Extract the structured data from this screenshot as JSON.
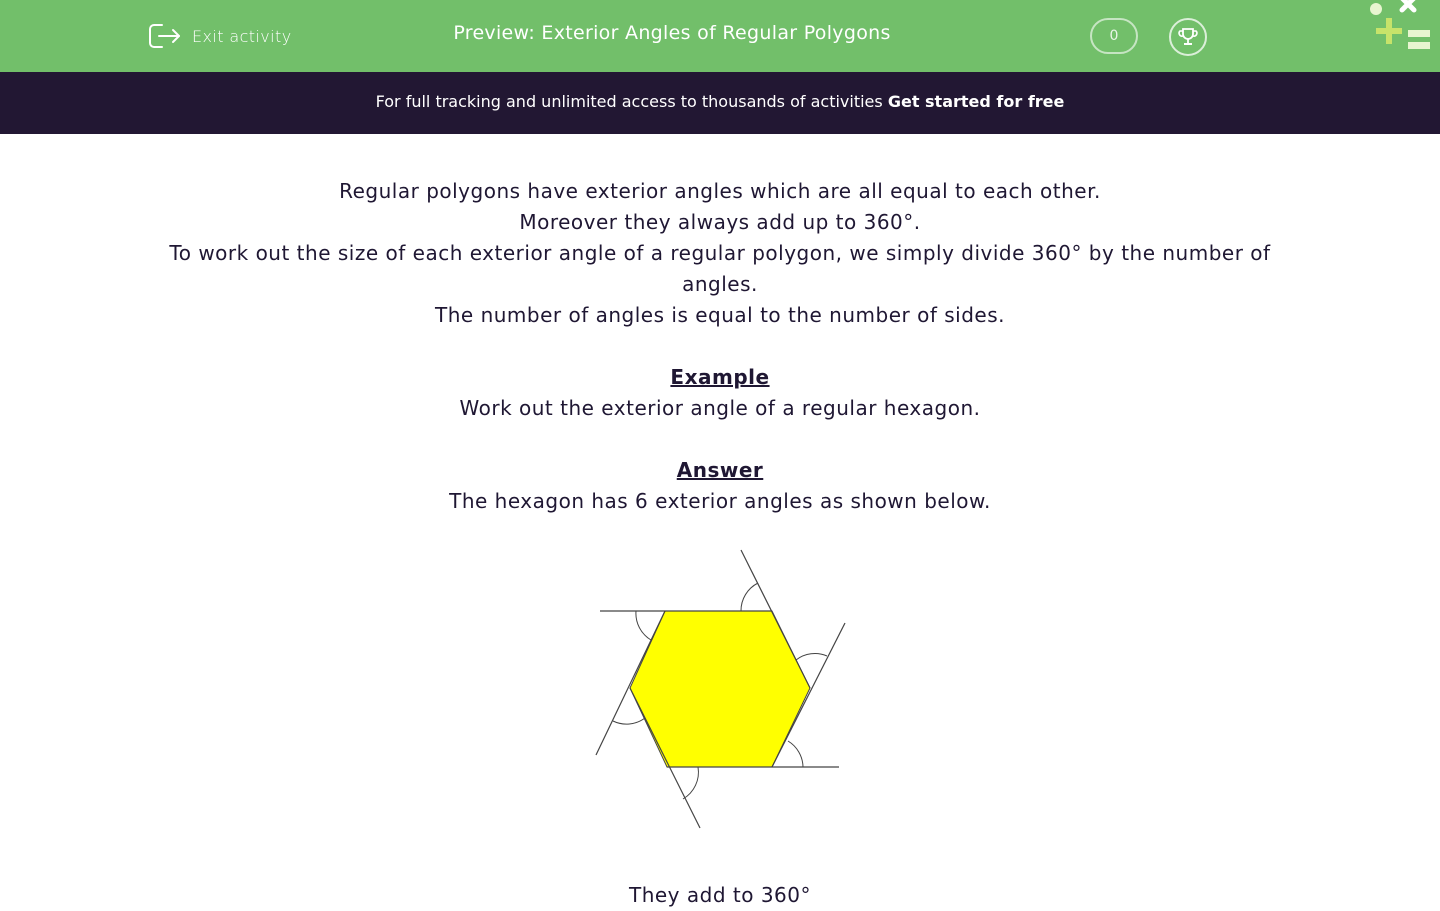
{
  "header": {
    "exit_label": "Exit activity",
    "title": "Preview: Exterior Angles of Regular Polygons",
    "score": "0",
    "exit_icon": "exit-icon",
    "trophy_icon": "trophy-icon",
    "logo_icon": "math-symbols-logo-icon",
    "bg_color": "#72bf6a"
  },
  "banner": {
    "text": "For full tracking and unlimited access to thousands of activities",
    "cta": "Get started for free",
    "bg_color": "#221733"
  },
  "content": {
    "intro_line1": "Regular polygons have exterior angles which are all equal to each other.",
    "intro_line2": "Moreover they always add up to 360°.",
    "intro_line3": "To work out the size of each exterior angle of a regular polygon, we simply divide 360° by the number of angles.",
    "intro_line4": "The number of angles is equal to the number of sides.",
    "example_heading": "Example",
    "example_text": "Work out the exterior angle of a regular hexagon.",
    "answer_heading": "Answer",
    "answer_text": "The hexagon has 6 exterior angles as shown below.",
    "footer_text": "They add to 360°",
    "diagram": {
      "shape": "regular hexagon",
      "sides": 6,
      "fill_color": "#ffff00"
    }
  }
}
